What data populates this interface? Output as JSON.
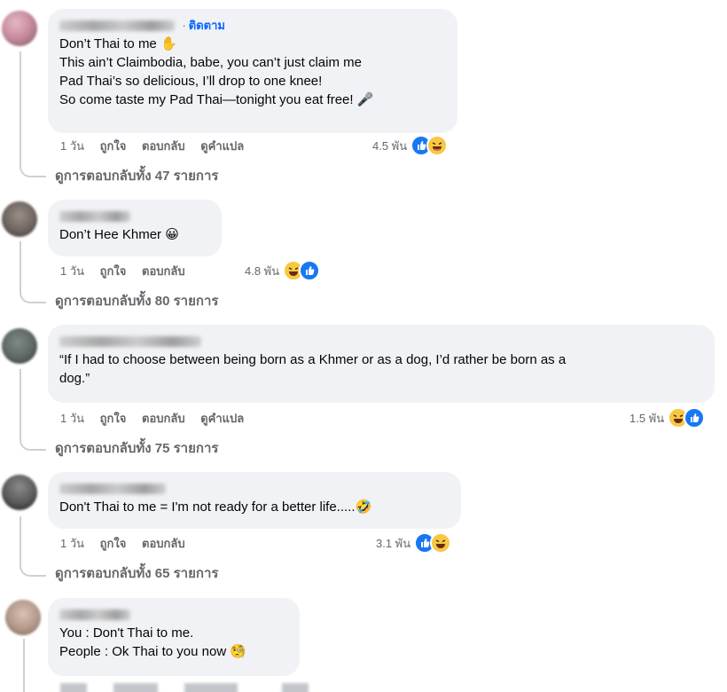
{
  "comments": [
    {
      "follow_label": "ติดตาม",
      "lines": [
        "Don’t Thai to me ✋",
        "This ain’t Claimbodia, babe, you can’t just claim me",
        "Pad Thai’s so delicious, I’ll drop to one knee!",
        "So come taste my Pad Thai—tonight you eat free! 🎤"
      ],
      "time": "1 วัน",
      "like": "ถูกใจ",
      "reply": "ตอบกลับ",
      "translate": "ดูคำแปล",
      "reaction_count": "4.5 พัน",
      "reactions": [
        "like-icon",
        "haha-icon"
      ],
      "replies": "ดูการตอบกลับทั้ง 47 รายการ"
    },
    {
      "lines": [
        "Don’t Hee Khmer 😀"
      ],
      "time": "1 วัน",
      "like": "ถูกใจ",
      "reply": "ตอบกลับ",
      "reaction_count": "4.8 พัน",
      "reactions": [
        "haha-icon",
        "like-icon"
      ],
      "replies": "ดูการตอบกลับทั้ง 80 รายการ"
    },
    {
      "lines": [
        "“If I had to choose between being born as a Khmer or as a dog, I’d rather be born as a",
        "dog.”"
      ],
      "time": "1 วัน",
      "like": "ถูกใจ",
      "reply": "ตอบกลับ",
      "translate": "ดูคำแปล",
      "reaction_count": "1.5 พัน",
      "reactions": [
        "haha-icon",
        "like-icon"
      ],
      "replies": "ดูการตอบกลับทั้ง 75 รายการ"
    },
    {
      "lines": [
        "Don't Thai to me = I'm not ready for a better life.....🤣"
      ],
      "time": "1 วัน",
      "like": "ถูกใจ",
      "reply": "ตอบกลับ",
      "reaction_count": "3.1 พัน",
      "reactions": [
        "like-icon",
        "haha-icon"
      ],
      "replies": "ดูการตอบกลับทั้ง 65 รายการ"
    },
    {
      "lines": [
        "You : Don't Thai to me.",
        "People : Ok Thai to you now 🧐"
      ]
    }
  ],
  "colors": {
    "bubble": "#f0f2f5",
    "meta_text": "#65676b",
    "follow_link": "#0866ff",
    "like_blue": "#1877f2",
    "haha_yellow": "#f7c842",
    "thread_line": "#ced0d4"
  }
}
